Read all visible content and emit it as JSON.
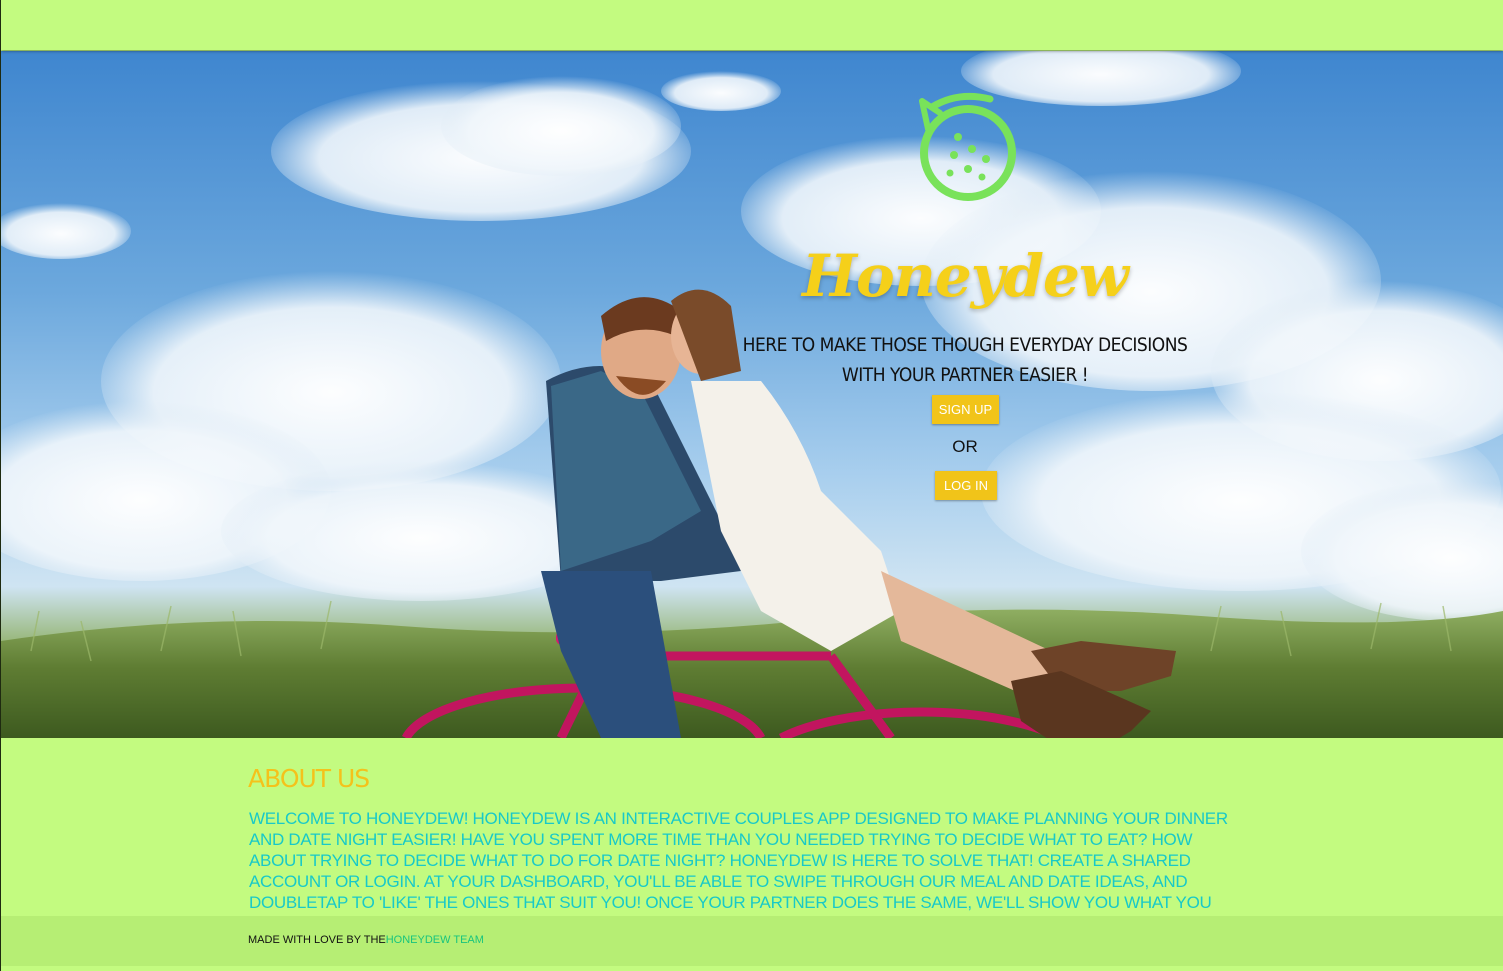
{
  "hero": {
    "brand": "Honeydew",
    "tagline_line1": "Here to make those though everyday decisions",
    "tagline_line2": "with your partner easier !",
    "signup_label": "Sign Up",
    "or_label": "or",
    "login_label": "Log In"
  },
  "about": {
    "title": "About Us",
    "text": "Welcome to Honeydew! Honeydew is an interactive couples app designed to make planning your dinner and date night easier! Have you spent more time than you needed trying to decide what to eat? How about trying to decide what to do for date night? Honeydew is here to solve that! Create a shared account or login. At your dashboard, you'll be able to swipe through our meal and date ideas, and doubletap to 'like' the ones that suit you! Once your partner does the same, we'll show you what you both liked!"
  },
  "footer": {
    "prefix": "Made with love by the",
    "team_link": "Honeydew Team"
  },
  "colors": {
    "page_bg": "#c3fb80",
    "accent_yellow": "#f1c419",
    "about_text": "#18c9c8",
    "footer_link": "#18c47e",
    "logo_green": "#79e25a"
  },
  "icons": {
    "logo": "honeydew-melon-icon"
  }
}
